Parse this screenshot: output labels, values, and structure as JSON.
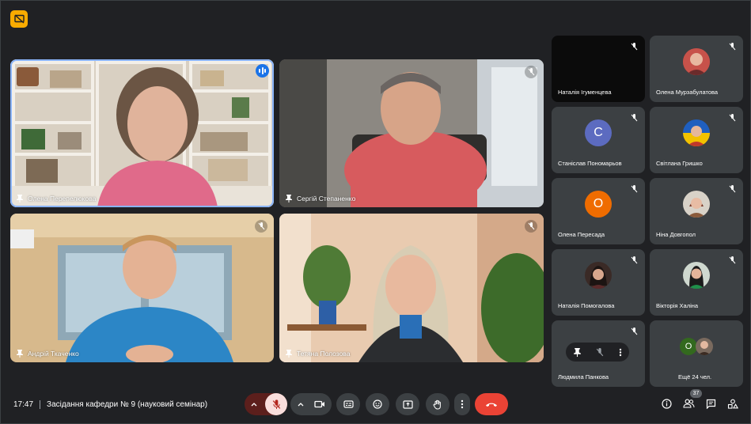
{
  "main_tiles": [
    {
      "name": "Олена Перепелюкова"
    },
    {
      "name": "Сергій Степаненко"
    },
    {
      "name": "Андрій Ткаченко"
    },
    {
      "name": "Тетяна Полозова"
    }
  ],
  "side_tiles": [
    {
      "name": "Наталія Ігуменцева"
    },
    {
      "name": "Олена Мурзабулатова"
    },
    {
      "name": "Станіслав Пономарьов",
      "initial": "С",
      "color": "#5c6bc0"
    },
    {
      "name": "Світлана Гришко"
    },
    {
      "name": "Олена Пересада",
      "initial": "О",
      "color": "#ef6c00"
    },
    {
      "name": "Ніна Довгопол"
    },
    {
      "name": "Наталія Помогалова"
    },
    {
      "name": "Вікторія Халіна"
    },
    {
      "name": "Людмила Панкова"
    },
    {
      "name": "Ещё 24 чел.",
      "initial": "О",
      "color": "#33691e"
    }
  ],
  "meeting": {
    "time": "17:47",
    "title": "Засідання кафедри № 9 (науковий семінар)"
  },
  "people_count": "37",
  "colors": {
    "accent": "#8ab4f8",
    "end_call": "#ea4335",
    "mic_off_bg": "#f28b82"
  }
}
